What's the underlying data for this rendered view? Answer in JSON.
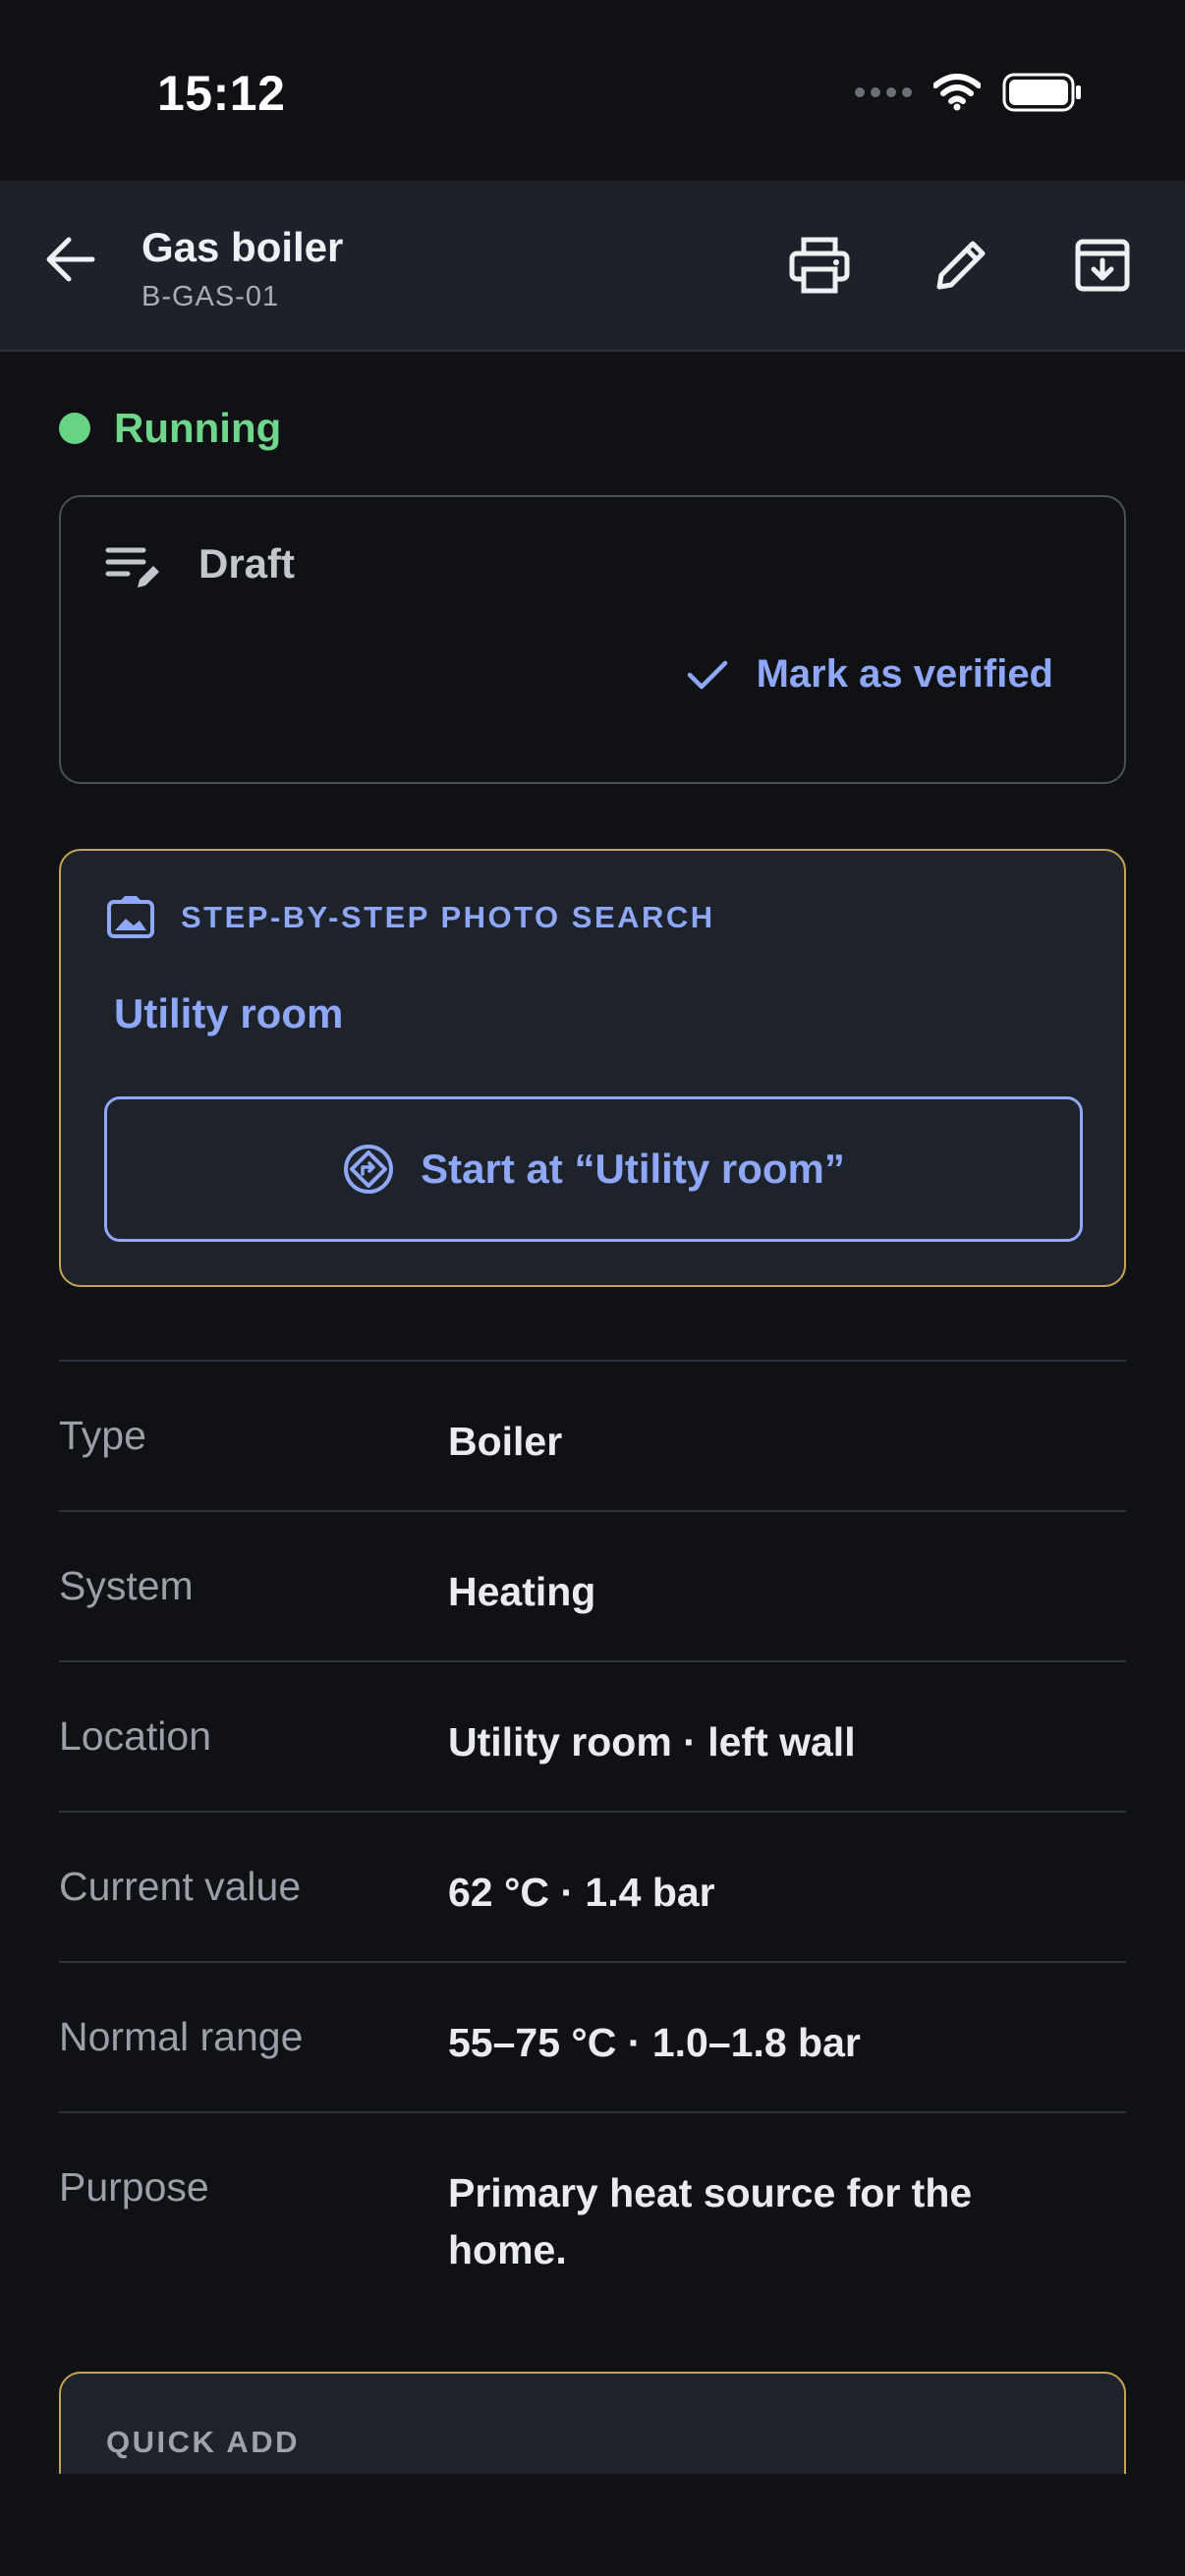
{
  "status_bar": {
    "time": "15:12"
  },
  "app_bar": {
    "title": "Gas boiler",
    "subtitle": "B-GAS-01",
    "actions": [
      "print-icon",
      "edit-icon",
      "archive-icon"
    ]
  },
  "status": {
    "label": "Running",
    "color": "#67d484"
  },
  "draft": {
    "label": "Draft",
    "verify_label": "Mark as verified"
  },
  "photo_search": {
    "heading": "STEP-BY-STEP PHOTO SEARCH",
    "location": "Utility room",
    "start_label": "Start at “Utility room”"
  },
  "details": [
    {
      "label": "Type",
      "value": "Boiler"
    },
    {
      "label": "System",
      "value": "Heating"
    },
    {
      "label": "Location",
      "value": "Utility room · left wall"
    },
    {
      "label": "Current value",
      "value": "62 °C · 1.4 bar"
    },
    {
      "label": "Normal range",
      "value": "55–75 °C · 1.0–1.8 bar"
    },
    {
      "label": "Purpose",
      "value": "Primary heat source for the home."
    }
  ],
  "quick_add": {
    "label": "QUICK ADD"
  },
  "colors": {
    "accent": "#8ea7f7",
    "highlight_border": "#c4a452",
    "running": "#67d484"
  }
}
